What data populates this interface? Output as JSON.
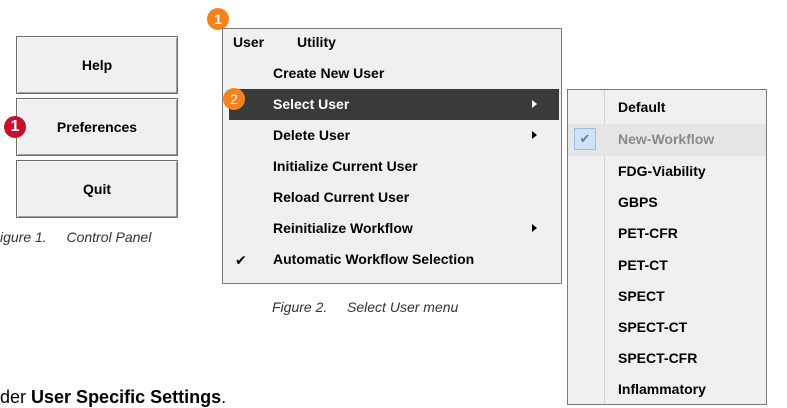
{
  "control_panel": {
    "buttons": [
      {
        "label": "Help"
      },
      {
        "label": "Preferences"
      },
      {
        "label": "Quit"
      }
    ],
    "badge": "1",
    "caption_number": "igure 1.",
    "caption_text": "Control Panel"
  },
  "menu": {
    "badge_top": "1",
    "badge_select": "2",
    "menubar": [
      "User",
      "Utility"
    ],
    "items": [
      {
        "label": "Create New User"
      },
      {
        "label": "Select User"
      },
      {
        "label": "Delete User"
      },
      {
        "label": "Initialize Current User"
      },
      {
        "label": "Reload Current User"
      },
      {
        "label": "Reinitialize Workflow"
      },
      {
        "label": "Automatic Workflow Selection"
      }
    ],
    "caption_number": "Figure 2.",
    "caption_text": "Select User menu"
  },
  "submenu": {
    "items": [
      {
        "label": "Default"
      },
      {
        "label": "New-Workflow"
      },
      {
        "label": "FDG-Viability"
      },
      {
        "label": "GBPS"
      },
      {
        "label": "PET-CFR"
      },
      {
        "label": "PET-CT"
      },
      {
        "label": "SPECT"
      },
      {
        "label": "SPECT-CT"
      },
      {
        "label": "SPECT-CFR"
      },
      {
        "label": "Inflammatory"
      }
    ]
  },
  "footer": {
    "prefix": "der ",
    "bold": "User Specific Settings",
    "suffix": "."
  },
  "colors": {
    "badge_red": "#c8102e",
    "badge_orange": "#f5821f",
    "selected_item": "#3a3a3a"
  }
}
